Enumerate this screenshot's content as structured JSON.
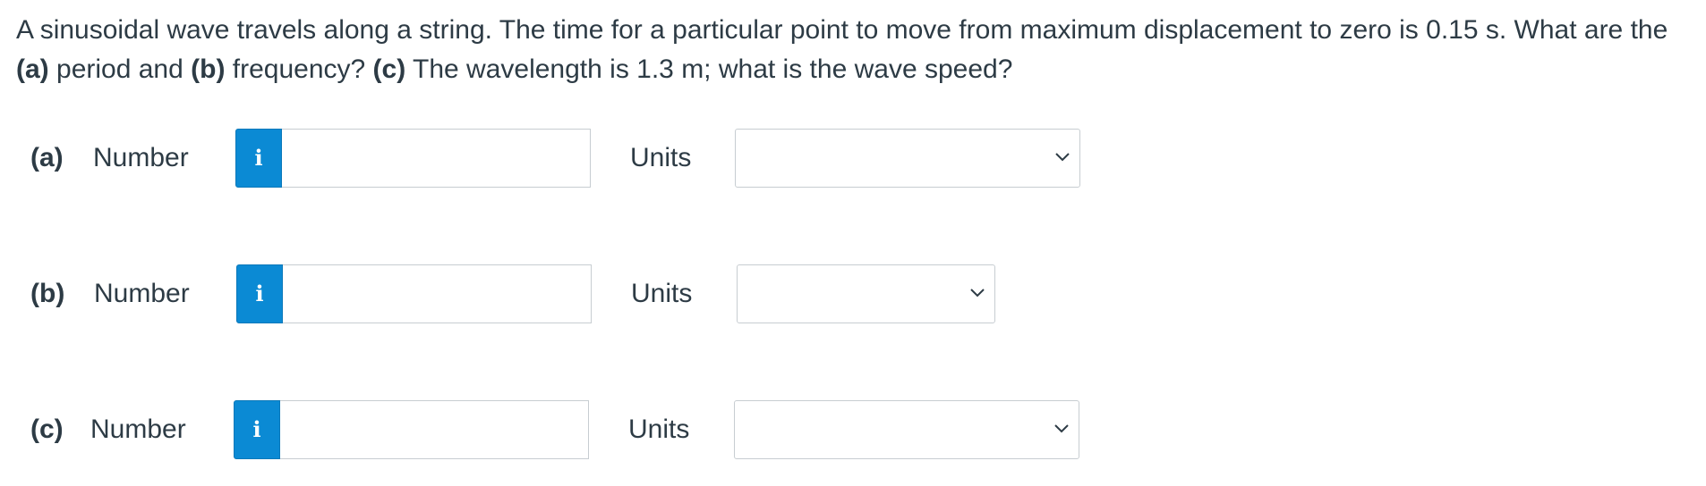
{
  "question": {
    "text_1": "A sinusoidal wave travels along a string. The time for a particular point to move from maximum displacement to zero is 0.15 s. What are the ",
    "part_a_ref": "(a)",
    "text_2": " period and ",
    "part_b_ref": "(b)",
    "text_3": " frequency? ",
    "part_c_ref": "(c)",
    "text_4": " The wavelength is 1.3 m; what is the wave speed?"
  },
  "parts": [
    {
      "label": "(a)",
      "number_label": "Number",
      "info_icon": "i",
      "number_value": "",
      "units_label": "Units",
      "units_selected": ""
    },
    {
      "label": "(b)",
      "number_label": "Number",
      "info_icon": "i",
      "number_value": "",
      "units_label": "Units",
      "units_selected": ""
    },
    {
      "label": "(c)",
      "number_label": "Number",
      "info_icon": "i",
      "number_value": "",
      "units_label": "Units",
      "units_selected": ""
    }
  ],
  "colors": {
    "info_button": "#0b8ad4",
    "text": "#2d3b45",
    "border": "#c7cdd1"
  },
  "icons": {
    "info": "info-icon",
    "dropdown": "chevron-down-icon"
  }
}
